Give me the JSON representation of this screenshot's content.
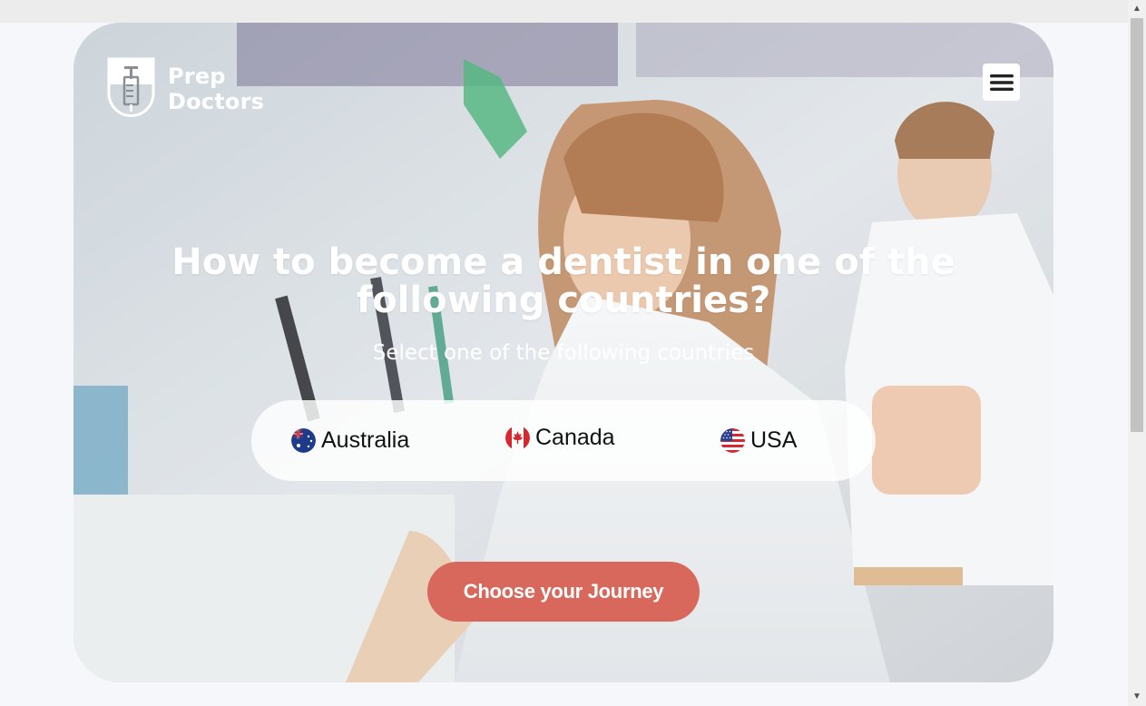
{
  "brand": {
    "name_line1": "Prep",
    "name_line2": "Doctors",
    "logo_icon": "syringe-shield-icon"
  },
  "header": {
    "menu_icon": "hamburger-menu-icon"
  },
  "hero": {
    "title": "How to become a dentist in one of the following countries?",
    "subtitle": "Select one of the following countries",
    "background": "dental-students-photo",
    "cta_label": "Choose your Journey"
  },
  "countries": [
    {
      "label": "Australia",
      "flag_icon": "australia-flag-icon"
    },
    {
      "label": "Canada",
      "flag_icon": "canada-flag-icon"
    },
    {
      "label": "USA",
      "flag_icon": "usa-flag-icon"
    }
  ],
  "colors": {
    "accent": "#d8685c",
    "page_bg": "#f6f7fb",
    "pill_bg": "#ffffff"
  }
}
